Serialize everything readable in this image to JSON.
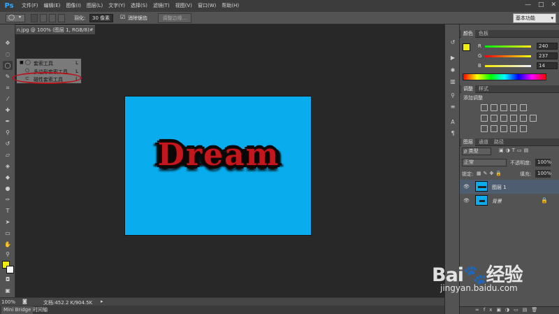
{
  "app": {
    "logo": "Ps"
  },
  "menu": [
    "文件(F)",
    "编辑(E)",
    "图像(I)",
    "图层(L)",
    "文字(Y)",
    "选择(S)",
    "滤镜(T)",
    "视图(V)",
    "窗口(W)",
    "帮助(H)"
  ],
  "window_buttons": [
    "—",
    "□",
    "✕"
  ],
  "options": {
    "feather_label": "羽化:",
    "feather_value": "30 像素",
    "antialias_label": "消除锯齿",
    "antialias_checked": true,
    "refine_edge": "调整边缘...",
    "workspace": "基本功能"
  },
  "document": {
    "tab_title": "n.jpg @ 100% (图层 1, RGB/8) *",
    "close": "×",
    "canvas_text": "Dream",
    "canvas_color": "#09adee"
  },
  "flyout": {
    "items": [
      {
        "label": "套索工具",
        "shortcut": "L",
        "selected": true
      },
      {
        "label": "多边形套索工具",
        "shortcut": "L",
        "selected": false
      },
      {
        "label": "磁性套索工具",
        "shortcut": "L",
        "selected": false
      }
    ]
  },
  "status": {
    "zoom": "100%",
    "doc_info": "文档:452.2 K/904.5K"
  },
  "bottom_tabs": [
    "Mini Bridge",
    "时间轴"
  ],
  "color_panel": {
    "tabs": [
      "颜色",
      "色板"
    ],
    "r": {
      "label": "R",
      "value": "240"
    },
    "g": {
      "label": "G",
      "value": "237"
    },
    "b": {
      "label": "B",
      "value": "14"
    },
    "foreground": "#f0ed0e"
  },
  "adjustments_panel": {
    "tabs": [
      "调整",
      "样式"
    ],
    "title": "添加调整"
  },
  "layers_panel": {
    "tabs": [
      "图层",
      "通道",
      "路径"
    ],
    "filter": "ρ 类型",
    "blend_mode": "正常",
    "opacity_label": "不透明度:",
    "opacity": "100%",
    "lock_label": "锁定:",
    "fill_label": "填充:",
    "fill": "100%",
    "layers": [
      {
        "name": "图层 1",
        "selected": true,
        "locked": false
      },
      {
        "name": "背景",
        "selected": false,
        "locked": true
      }
    ]
  },
  "watermark": {
    "logo": "Bai🐾经验",
    "url": "jingyan.baidu.com"
  }
}
